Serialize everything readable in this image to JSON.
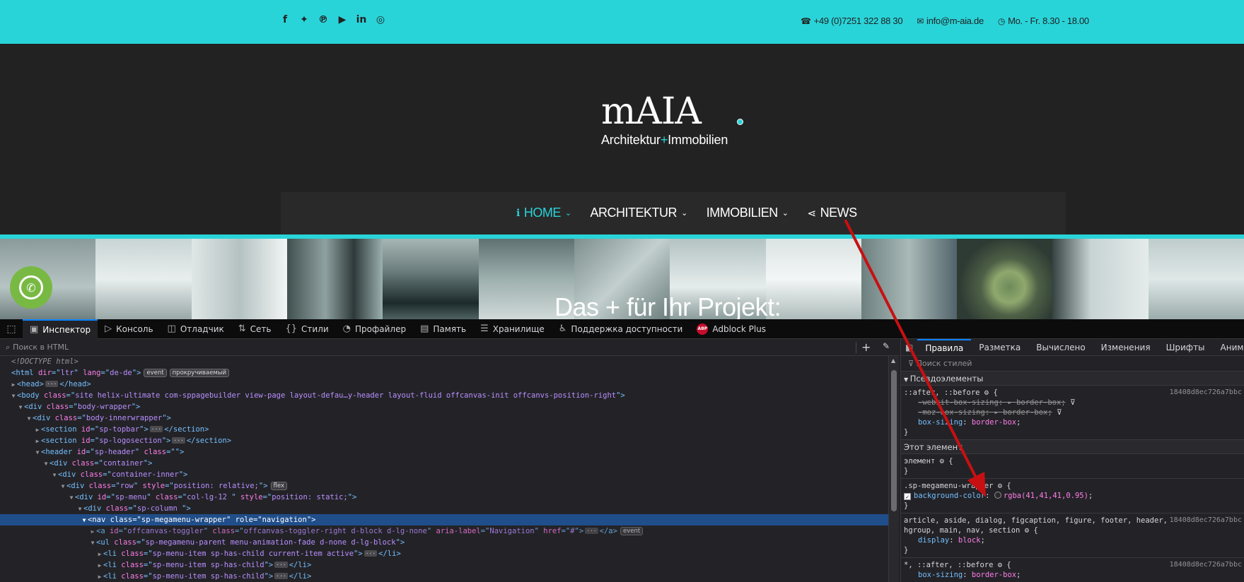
{
  "site": {
    "topbar": {
      "social_icons": [
        "facebook-icon",
        "twitter-icon",
        "pinterest-icon",
        "youtube-icon",
        "linkedin-icon",
        "instagram-icon"
      ],
      "phone": "+49 (0)7251 322 88 30",
      "email": "info@m-aia.de",
      "hours": "Mo. - Fr. 8.30 - 18.00"
    },
    "logo": {
      "main": "mAIA",
      "sub_left": "Architektur",
      "sub_plus": "+",
      "sub_right": "Immobilien"
    },
    "nav": [
      {
        "label": "HOME",
        "active": true
      },
      {
        "label": "ARCHITEKTUR"
      },
      {
        "label": "IMMOBILIEN"
      },
      {
        "label": "NEWS"
      }
    ],
    "headline": "Das + für Ihr Projekt:",
    "accent": "#29d4d9"
  },
  "devtools": {
    "tabs": [
      "Инспектор",
      "Консоль",
      "Отладчик",
      "Сеть",
      "Стили",
      "Профайлер",
      "Память",
      "Хранилище",
      "Поддержка доступности",
      "Adblock Plus"
    ],
    "active_tab": "Инспектор",
    "html_search_placeholder": "Поиск в HTML",
    "right_tabs": [
      "Правила",
      "Разметка",
      "Вычислено",
      "Изменения",
      "Шрифты",
      "Анимации"
    ],
    "right_active": "Правила",
    "styles_filter_placeholder": "Поиск стилей",
    "tree": {
      "doctype": "<!DOCTYPE html>",
      "html_dir": "ltr",
      "html_lang": "de-de",
      "badge_event": "event",
      "badge_scroll": "прокручиваемый",
      "badge_flex": "flex",
      "body_class": "site helix-ultimate com-sppagebuilder view-page layout-defau…y-header layout-fluid offcanvas-init offcanvs-position-right",
      "body_wrapper": "body-wrapper",
      "body_innerwrapper": "body-innerwrapper",
      "topbar_id": "sp-topbar",
      "logosection_id": "sp-logosection",
      "header_id": "sp-header",
      "header_class": "",
      "container": "container",
      "container_inner": "container-inner",
      "row_class": "row",
      "row_style": "position: relative;",
      "menu_id": "sp-menu",
      "menu_class": "col-lg-12 ",
      "menu_style": "position: static;",
      "column": "sp-column ",
      "nav_class": "sp-megamenu-wrapper",
      "nav_role": "navigation",
      "a_id": "offcanvas-toggler",
      "a_class": "offcanvas-toggler-right d-block d-lg-none",
      "a_label": "Navigation",
      "a_href": "#",
      "ul_class": "sp-megamenu-parent menu-animation-fade d-none d-lg-block",
      "li1_class": "sp-menu-item sp-has-child current-item active",
      "li2_class": "sp-menu-item sp-has-child",
      "li3_class": "sp-menu-item sp-has-child"
    },
    "rules": {
      "pseudo_title": "Псевдоэлементы",
      "pseudo_selector": "::after, ::before",
      "src_hash": "18408d8ec726a7bbc",
      "webkit_prop": "-webkit-box-sizing",
      "moz_prop": "-moz-box-sizing",
      "box_prop": "box-sizing",
      "box_val": "border-box",
      "this_element": "Этот элемент",
      "element_label": "элемент",
      "mega_selector": ".sp-megamenu-wrapper",
      "bg_prop": "background-color",
      "bg_val": "rgba(41,41,41,0.95)",
      "block_selector": "article, aside, dialog, figcaption, figure, footer, header,",
      "block_selector2": "hgroup, main, nav, section",
      "display_prop": "display",
      "display_val": "block",
      "star_selector": "*, ::after, ::before"
    }
  }
}
